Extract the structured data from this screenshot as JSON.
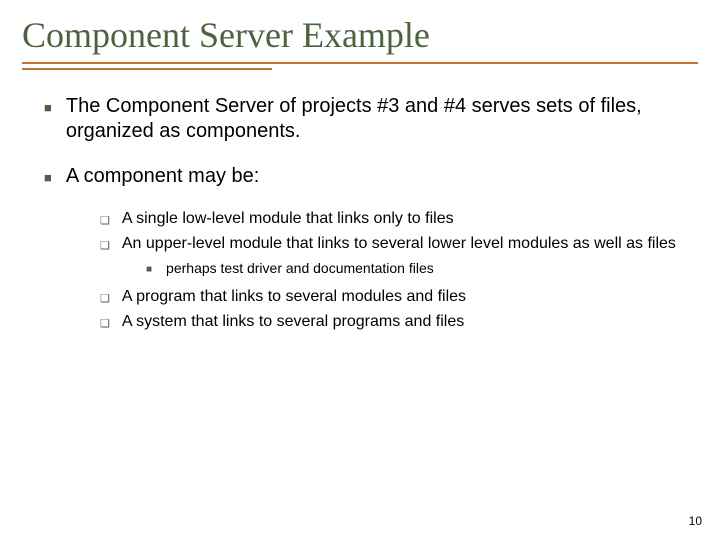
{
  "title": "Component Server Example",
  "bullets": {
    "p1": "The Component Server of projects #3 and #4 serves sets of files, organized as components.",
    "p2": "A component may be:",
    "s1": "A single low-level module that links only to files",
    "s2": "An upper-level module that links to several lower level modules as well as files",
    "s2a": "perhaps test driver and documentation files",
    "s3": "A program that links to several modules and files",
    "s4": "A system that links to several programs and files"
  },
  "page_number": "10"
}
